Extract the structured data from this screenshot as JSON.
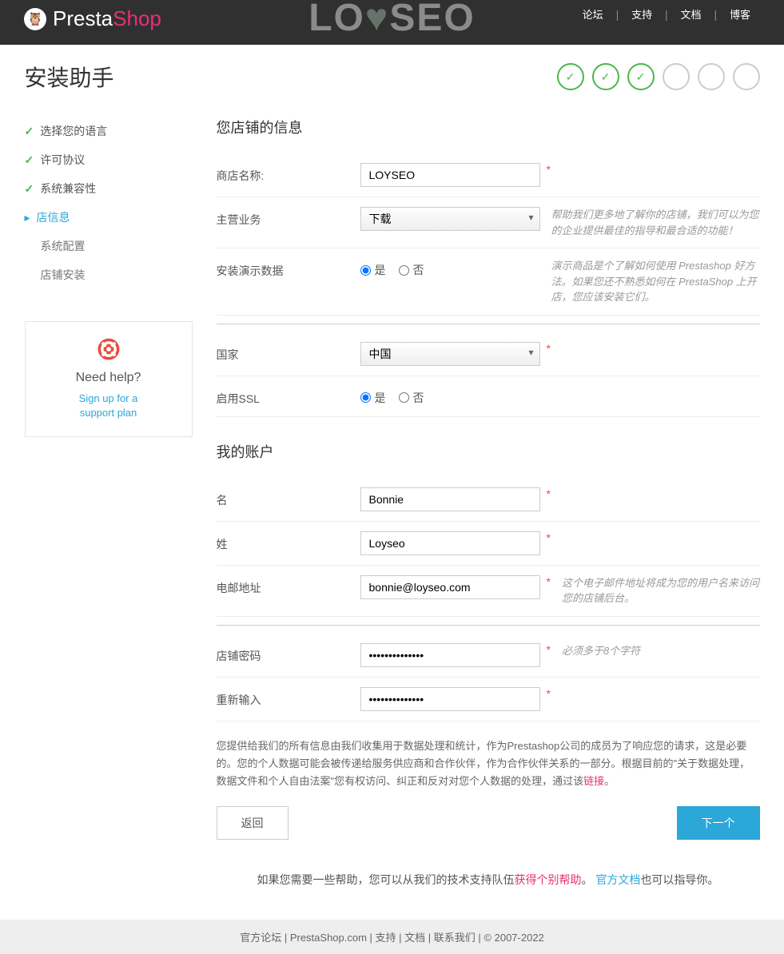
{
  "topnav": {
    "forum": "论坛",
    "support": "支持",
    "docs": "文档",
    "blog": "博客"
  },
  "logo": {
    "presta": "Presta",
    "shop": "Shop"
  },
  "watermark": {
    "lo": "LO",
    "seo": "SEO"
  },
  "title": "安装助手",
  "progress": {
    "done": 3,
    "total": 6
  },
  "sidebar": {
    "items": [
      {
        "label": "选择您的语言",
        "state": "done"
      },
      {
        "label": "许可协议",
        "state": "done"
      },
      {
        "label": "系统兼容性",
        "state": "done"
      },
      {
        "label": "店信息",
        "state": "current"
      },
      {
        "label": "系统配置",
        "state": "future"
      },
      {
        "label": "店铺安装",
        "state": "future"
      }
    ]
  },
  "help": {
    "title": "Need help?",
    "link1": "Sign up for a",
    "link2": "support plan"
  },
  "section1": {
    "heading": "您店铺的信息",
    "shopname_label": "商店名称:",
    "shopname_value": "LOYSEO",
    "activity_label": "主营业务",
    "activity_value": "下载",
    "activity_hint": "帮助我们更多地了解你的店铺，我们可以为您的企业提供最佳的指导和最合适的功能！",
    "demo_label": "安装演示数据",
    "demo_hint": "演示商品是个了解如何使用 Prestashop 好方法。如果您还不熟悉如何在 PrestaShop 上开店，您应该安装它们。",
    "yes": "是",
    "no": "否",
    "country_label": "国家",
    "country_value": "中国",
    "ssl_label": "启用SSL"
  },
  "section2": {
    "heading": "我的账户",
    "firstname_label": "名",
    "firstname_value": "Bonnie",
    "lastname_label": "姓",
    "lastname_value": "Loyseo",
    "email_label": "电邮地址",
    "email_value": "bonnie@loyseo.com",
    "email_hint": "这个电子邮件地址将成为您的用户名来访问您的店铺后台。",
    "password_label": "店铺密码",
    "password_value": "••••••••••••••",
    "password_hint": "必须多于8个字符",
    "confirm_label": "重新输入",
    "confirm_value": "••••••••••••••"
  },
  "disclaimer": {
    "text1": "您提供给我们的所有信息由我们收集用于数据处理和统计，作为Prestashop公司的成员为了响应您的请求，这是必要的。您的个人数据可能会被传递给服务供应商和合作伙伴，作为合作伙伴关系的一部分。根据目前的\"关于数据处理，数据文件和个人自由法案\"您有权访问、纠正和反对对您个人数据的处理，通过该",
    "link": "链接",
    "text2": "。"
  },
  "buttons": {
    "back": "返回",
    "next": "下一个"
  },
  "helpfooter": {
    "t1": "如果您需要一些帮助，您可以从我们的技术支持队伍",
    "l1": "获得个别帮助",
    "t2": "。 ",
    "l2": "官方文档",
    "t3": "也可以指导你。"
  },
  "footer": {
    "forum": "官方论坛",
    "site": "PrestaShop.com",
    "support": "支持",
    "docs": "文档",
    "contact": "联系我们",
    "copyright": "© 2007-2022"
  }
}
